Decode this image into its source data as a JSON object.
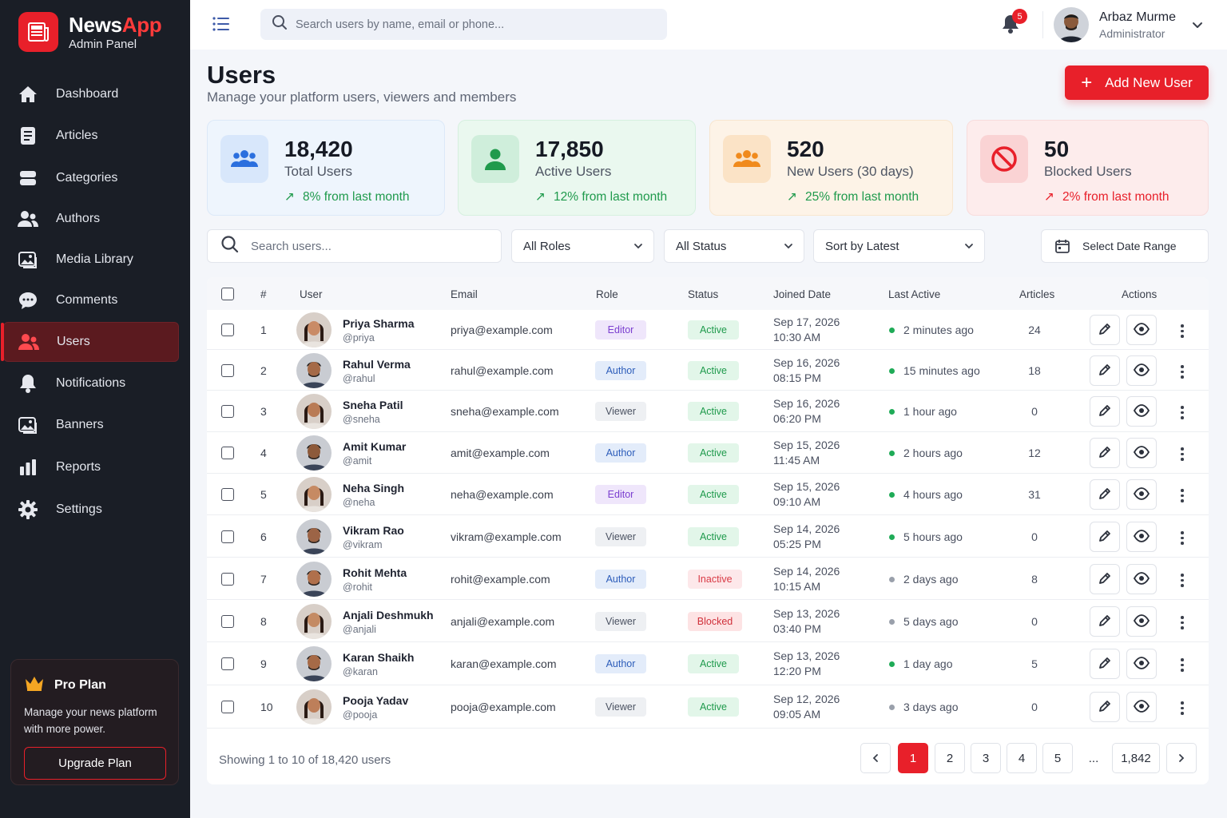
{
  "brand": {
    "name_part1": "News",
    "name_part2": "App",
    "subtitle": "Admin Panel"
  },
  "sidebar": {
    "items": [
      {
        "label": "Dashboard",
        "icon": "home-icon"
      },
      {
        "label": "Articles",
        "icon": "document-icon"
      },
      {
        "label": "Categories",
        "icon": "layers-icon"
      },
      {
        "label": "Authors",
        "icon": "users-icon"
      },
      {
        "label": "Media Library",
        "icon": "image-icon"
      },
      {
        "label": "Comments",
        "icon": "comment-icon"
      },
      {
        "label": "Users",
        "icon": "users-icon",
        "active": true
      },
      {
        "label": "Notifications",
        "icon": "bell-icon"
      },
      {
        "label": "Banners",
        "icon": "image-icon"
      },
      {
        "label": "Reports",
        "icon": "bar-chart-icon"
      },
      {
        "label": "Settings",
        "icon": "gear-icon"
      }
    ],
    "pro": {
      "title": "Pro Plan",
      "description": "Manage your news platform with more power.",
      "button": "Upgrade Plan"
    }
  },
  "header": {
    "search_placeholder": "Search users by name, email or phone...",
    "notification_count": "5",
    "user_name": "Arbaz Murme",
    "user_role": "Administrator"
  },
  "page": {
    "title": "Users",
    "subtitle": "Manage your platform users, viewers and members",
    "add_button": "Add New User"
  },
  "stats": [
    {
      "value": "18,420",
      "label": "Total Users",
      "trend": "8% from last month",
      "color": "#2b6fde"
    },
    {
      "value": "17,850",
      "label": "Active Users",
      "trend": "12% from last month",
      "color": "#1f9a4c"
    },
    {
      "value": "520",
      "label": "New Users (30 days)",
      "trend": "25% from last month",
      "color": "#f08a1c"
    },
    {
      "value": "50",
      "label": "Blocked Users",
      "trend": "2% from last month",
      "color": "#e8202a"
    }
  ],
  "filters": {
    "search_placeholder": "Search users...",
    "roles": "All Roles",
    "status": "All Status",
    "sort": "Sort by Latest",
    "date_range": "Select Date Range"
  },
  "table": {
    "headers": {
      "num": "#",
      "user": "User",
      "email": "Email",
      "role": "Role",
      "status": "Status",
      "joined": "Joined Date",
      "last_active": "Last Active",
      "articles": "Articles",
      "actions": "Actions"
    },
    "rows": [
      {
        "num": "1",
        "name": "Priya Sharma",
        "handle": "@priya",
        "email": "priya@example.com",
        "role": "Editor",
        "status": "Active",
        "date": "Sep 17, 2026",
        "time": "10:30 AM",
        "last_active": "2 minutes ago",
        "online": true,
        "articles": "24"
      },
      {
        "num": "2",
        "name": "Rahul Verma",
        "handle": "@rahul",
        "email": "rahul@example.com",
        "role": "Author",
        "status": "Active",
        "date": "Sep 16, 2026",
        "time": "08:15 PM",
        "last_active": "15 minutes ago",
        "online": true,
        "articles": "18"
      },
      {
        "num": "3",
        "name": "Sneha Patil",
        "handle": "@sneha",
        "email": "sneha@example.com",
        "role": "Viewer",
        "status": "Active",
        "date": "Sep 16, 2026",
        "time": "06:20 PM",
        "last_active": "1 hour ago",
        "online": true,
        "articles": "0"
      },
      {
        "num": "4",
        "name": "Amit Kumar",
        "handle": "@amit",
        "email": "amit@example.com",
        "role": "Author",
        "status": "Active",
        "date": "Sep 15, 2026",
        "time": "11:45 AM",
        "last_active": "2 hours ago",
        "online": true,
        "articles": "12"
      },
      {
        "num": "5",
        "name": "Neha Singh",
        "handle": "@neha",
        "email": "neha@example.com",
        "role": "Editor",
        "status": "Active",
        "date": "Sep 15, 2026",
        "time": "09:10 AM",
        "last_active": "4 hours ago",
        "online": true,
        "articles": "31"
      },
      {
        "num": "6",
        "name": "Vikram Rao",
        "handle": "@vikram",
        "email": "vikram@example.com",
        "role": "Viewer",
        "status": "Active",
        "date": "Sep 14, 2026",
        "time": "05:25 PM",
        "last_active": "5 hours ago",
        "online": true,
        "articles": "0"
      },
      {
        "num": "7",
        "name": "Rohit Mehta",
        "handle": "@rohit",
        "email": "rohit@example.com",
        "role": "Author",
        "status": "Inactive",
        "date": "Sep 14, 2026",
        "time": "10:15 AM",
        "last_active": "2 days ago",
        "online": false,
        "articles": "8"
      },
      {
        "num": "8",
        "name": "Anjali Deshmukh",
        "handle": "@anjali",
        "email": "anjali@example.com",
        "role": "Viewer",
        "status": "Blocked",
        "date": "Sep 13, 2026",
        "time": "03:40 PM",
        "last_active": "5 days ago",
        "online": false,
        "articles": "0"
      },
      {
        "num": "9",
        "name": "Karan Shaikh",
        "handle": "@karan",
        "email": "karan@example.com",
        "role": "Author",
        "status": "Active",
        "date": "Sep 13, 2026",
        "time": "12:20 PM",
        "last_active": "1 day ago",
        "online": true,
        "articles": "5"
      },
      {
        "num": "10",
        "name": "Pooja Yadav",
        "handle": "@pooja",
        "email": "pooja@example.com",
        "role": "Viewer",
        "status": "Active",
        "date": "Sep 12, 2026",
        "time": "09:05 AM",
        "last_active": "3 days ago",
        "online": false,
        "articles": "0"
      }
    ]
  },
  "pagination": {
    "showing": "Showing 1 to 10 of 18,420 users",
    "pages": [
      "1",
      "2",
      "3",
      "4",
      "5"
    ],
    "ellipsis": "...",
    "last": "1,842"
  }
}
